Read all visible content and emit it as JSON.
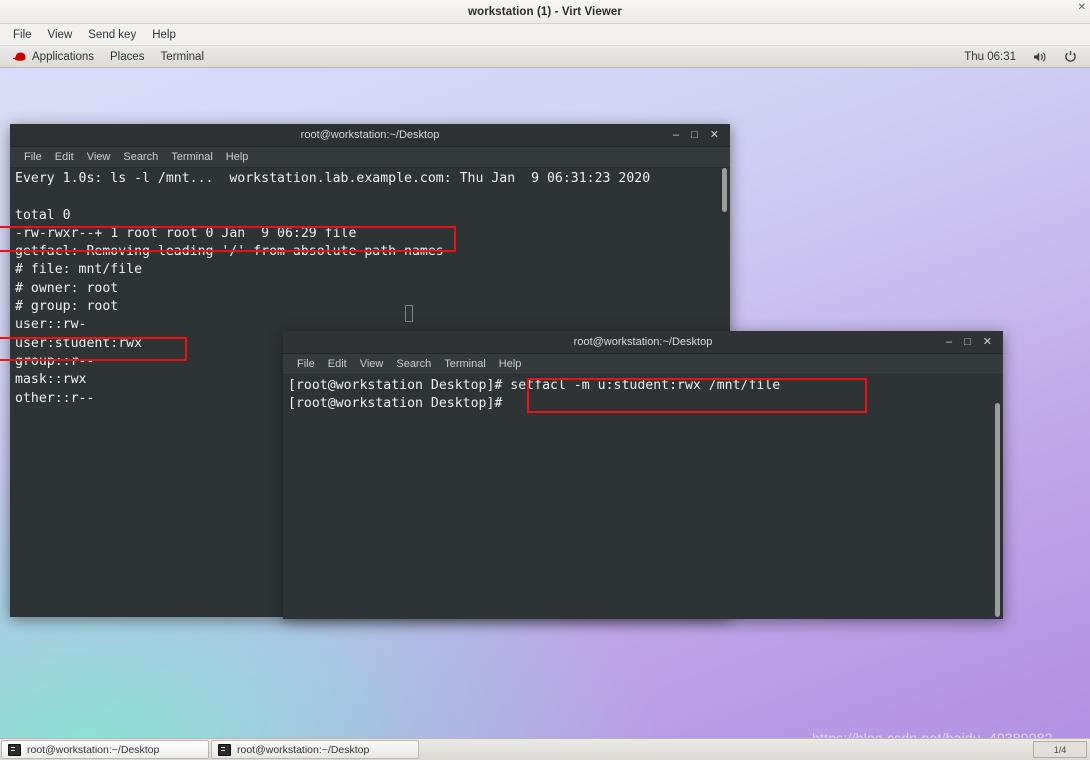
{
  "viewer": {
    "title": "workstation (1) - Virt Viewer",
    "close_hint": "✕",
    "menu": [
      {
        "label": "File"
      },
      {
        "label": "View"
      },
      {
        "label": "Send key"
      },
      {
        "label": "Help"
      }
    ]
  },
  "gnome_panel": {
    "logo_icon": "redhat-logo-icon",
    "left_items": [
      {
        "label": "Applications"
      },
      {
        "label": "Places"
      },
      {
        "label": "Terminal"
      }
    ],
    "clock": "Thu 06:31",
    "volume_icon": "volume-icon",
    "power_icon": "power-icon"
  },
  "colors": {
    "annotation_red": "#ee1111",
    "terminal_bg": "#2e3436",
    "terminal_fg": "#f0f0f0",
    "panel_bg": "#ebeae8",
    "wallpaper_teal": "#8fe0d8",
    "wallpaper_purple": "#b48fe2"
  },
  "terminal_window_1": {
    "title": "root@workstation:~/Desktop",
    "menu": [
      {
        "label": "File"
      },
      {
        "label": "Edit"
      },
      {
        "label": "View"
      },
      {
        "label": "Search"
      },
      {
        "label": "Terminal"
      },
      {
        "label": "Help"
      }
    ],
    "window_buttons": {
      "minimize": "–",
      "maximize": "□",
      "close": "✕"
    },
    "lines": [
      "Every 1.0s: ls -l /mnt...  workstation.lab.example.com: Thu Jan  9 06:31:23 2020",
      "",
      "total 0",
      "-rw-rwxr--+ 1 root root 0 Jan  9 06:29 file",
      "getfacl: Removing leading '/' from absolute path names",
      "# file: mnt/file",
      "# owner: root",
      "# group: root",
      "user::rw-",
      "user:student:rwx",
      "group::r--",
      "mask::rwx",
      "other::r--"
    ]
  },
  "terminal_window_2": {
    "title": "root@workstation:~/Desktop",
    "menu": [
      {
        "label": "File"
      },
      {
        "label": "Edit"
      },
      {
        "label": "View"
      },
      {
        "label": "Search"
      },
      {
        "label": "Terminal"
      },
      {
        "label": "Help"
      }
    ],
    "window_buttons": {
      "minimize": "–",
      "maximize": "□",
      "close": "✕"
    },
    "lines": [
      "[root@workstation Desktop]# setfacl -m u:student:rwx /mnt/file",
      "[root@workstation Desktop]# "
    ]
  },
  "taskbar": {
    "items": [
      {
        "label": "root@workstation:~/Desktop",
        "icon": "terminal-icon"
      },
      {
        "label": "root@workstation:~/Desktop",
        "icon": "terminal-icon"
      }
    ],
    "pager_label": "1/4"
  },
  "watermark": {
    "text": "https://blog.csdn.net/baidu_40389082"
  }
}
